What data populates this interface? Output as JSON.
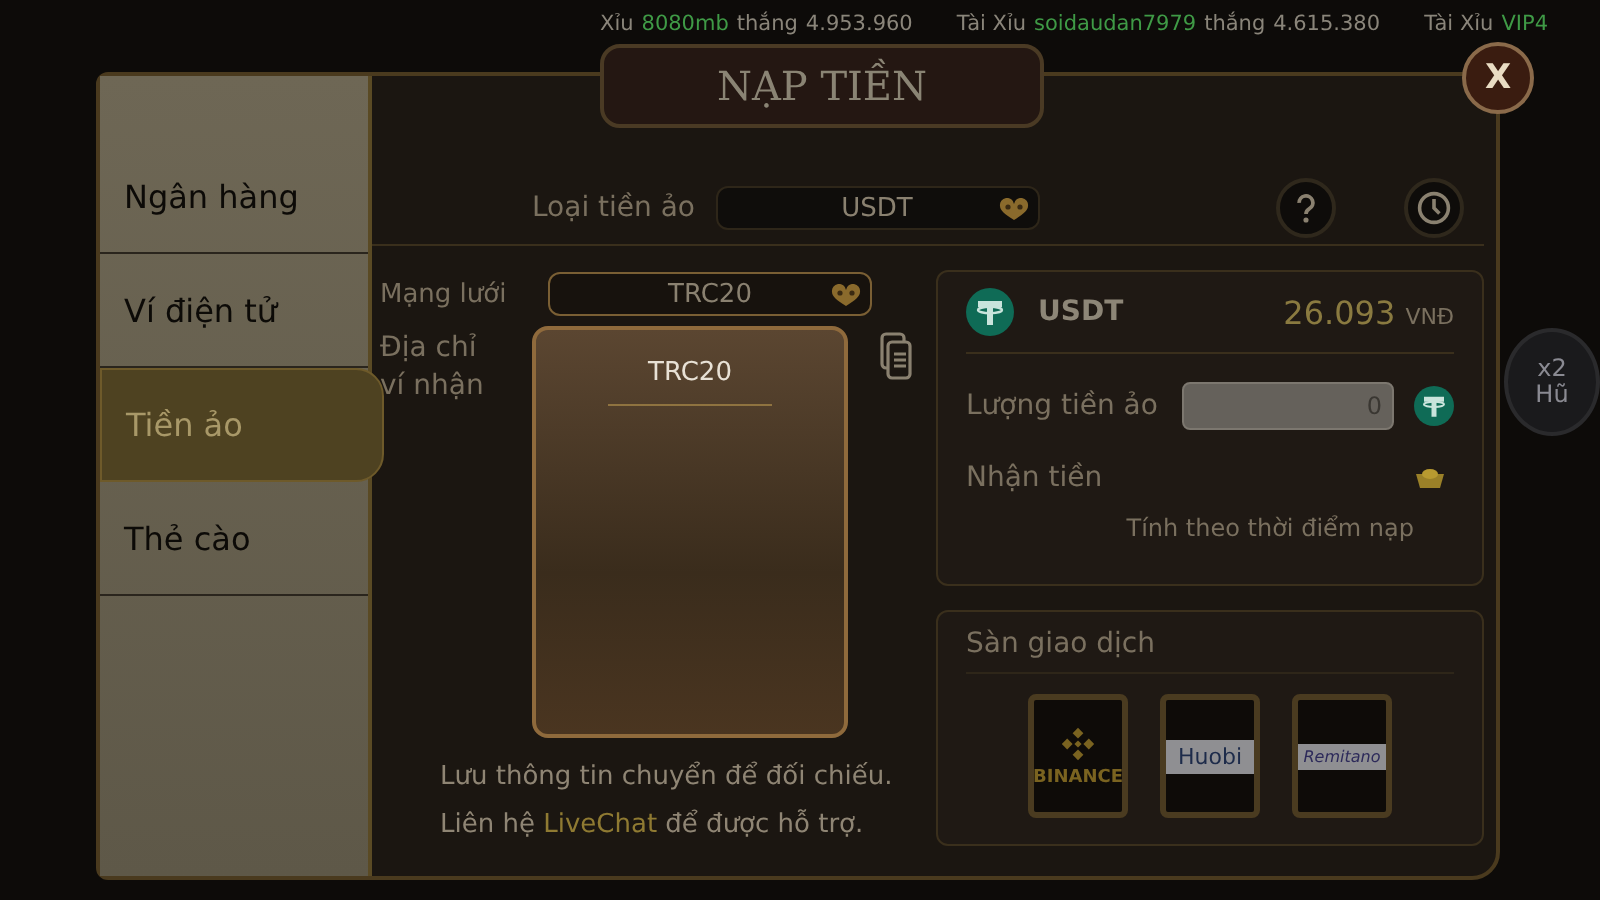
{
  "ticker": [
    {
      "game": "Xỉu",
      "user": "8080mb",
      "verb": "thắng",
      "amount": "4.953.960"
    },
    {
      "game": "Tài Xỉu",
      "user": "soidaudan7979",
      "verb": "thắng",
      "amount": "4.615.380"
    },
    {
      "game": "Tài Xỉu",
      "user": "VIP4"
    }
  ],
  "side_badge": {
    "top": "x2",
    "bottom": "Hũ"
  },
  "dialog": {
    "title": "NẠP TIỀN",
    "close": "X"
  },
  "sidebar": {
    "items": [
      {
        "label": "Ngân hàng",
        "selected": false
      },
      {
        "label": "Ví điện tử",
        "selected": false
      },
      {
        "label": "Tiền ảo",
        "selected": true
      },
      {
        "label": "Thẻ cào",
        "selected": false
      }
    ]
  },
  "currency": {
    "label": "Loại tiền ảo",
    "value": "USDT"
  },
  "network": {
    "label": "Mạng lưới",
    "value": "TRC20",
    "expanded": true,
    "options": [
      "TRC20"
    ]
  },
  "address": {
    "label": "Địa chỉ ví nhận"
  },
  "notes": [
    {
      "before": "Lưu thông tin chuyển để đối chiếu."
    },
    {
      "before": "Liên hệ",
      "link": "LiveChat",
      "after": "để được hỗ trợ."
    }
  ],
  "rate_card": {
    "coin": "USDT",
    "rate": "26.093",
    "unit": "VNĐ",
    "amount_label": "Lượng tiền ảo",
    "amount_value": "0",
    "receive_label": "Nhận tiền",
    "note": "Tính theo thời điểm nạp"
  },
  "exchanges": {
    "title": "Sàn giao dịch",
    "items": [
      {
        "kind": "binance",
        "label": "BINANCE"
      },
      {
        "kind": "huobi",
        "label": "Huobi"
      },
      {
        "kind": "remitano",
        "label": "Remitano"
      }
    ]
  }
}
